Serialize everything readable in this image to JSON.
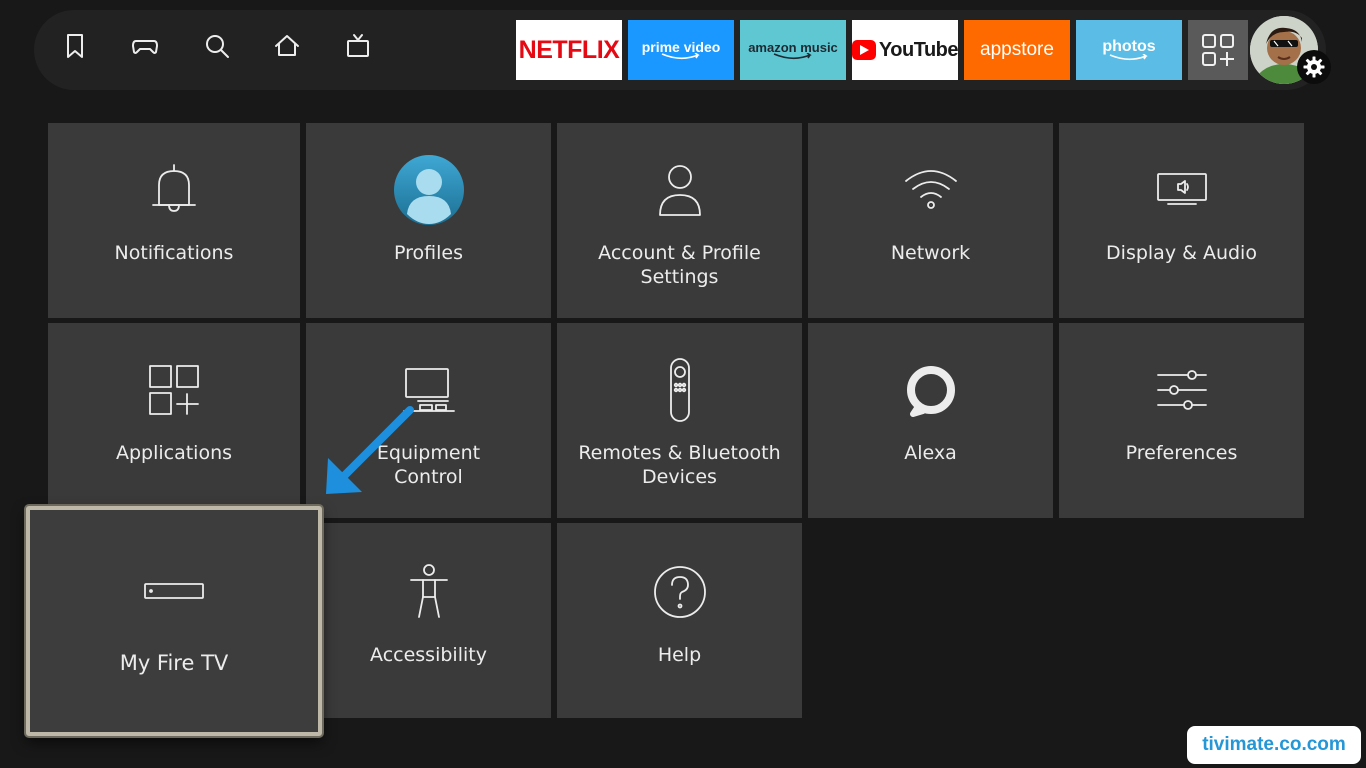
{
  "nav": {
    "icons": [
      "bookmark-icon",
      "gamepad-icon",
      "search-icon",
      "home-icon",
      "live-tv-icon"
    ]
  },
  "apps": {
    "netflix": "NETFLIX",
    "prime_video": "prime video",
    "amazon_music": "amazon music",
    "youtube": "YouTube",
    "appstore": "appstore",
    "photos": "photos"
  },
  "colors": {
    "netflix": "#e50914",
    "prime_video": "#1a98ff",
    "amazon_music": "#5fc7d2",
    "appstore": "#ff6a00",
    "photos": "#5bbce6",
    "tile": "#3a3a3a",
    "focus_border": "#bdb8a8",
    "arrow": "#1e8fdc",
    "background": "#181818"
  },
  "settings": {
    "notifications": "Notifications",
    "profiles": "Profiles",
    "account_line1": "Account & Profile",
    "account_line2": "Settings",
    "network": "Network",
    "display_audio": "Display & Audio",
    "applications": "Applications",
    "equipment_line1": "Equipment",
    "equipment_line2": "Control",
    "remotes_line1": "Remotes & Bluetooth",
    "remotes_line2": "Devices",
    "alexa": "Alexa",
    "preferences": "Preferences",
    "my_fire_tv": "My Fire TV",
    "accessibility": "Accessibility",
    "help": "Help"
  },
  "focused_item": "My Fire TV",
  "watermark": "tivimate.co.com"
}
